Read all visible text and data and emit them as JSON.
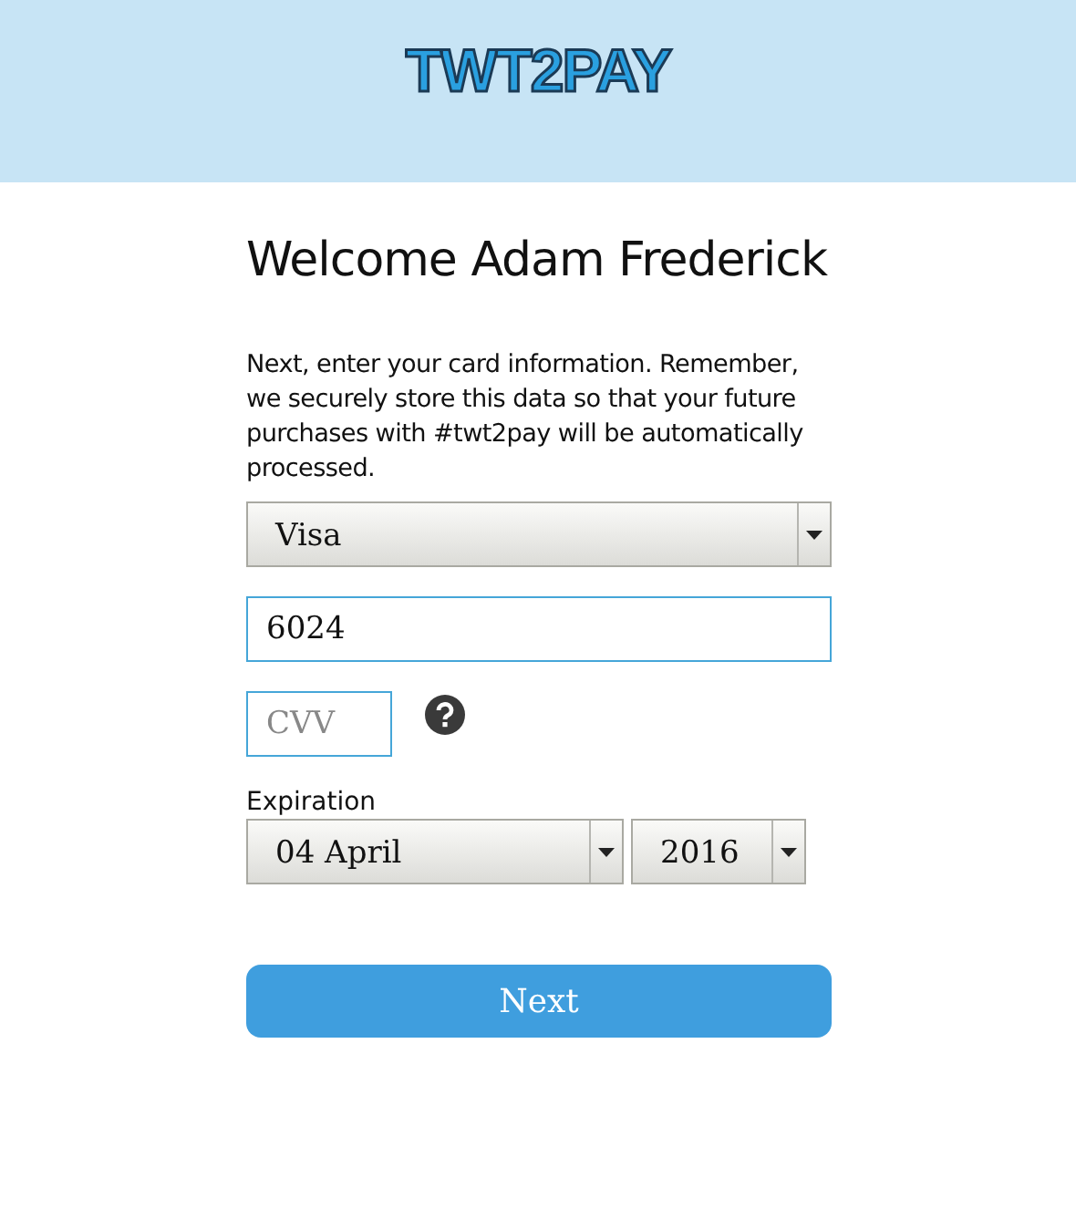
{
  "header": {
    "logo": "TWT2PAY"
  },
  "heading": "Welcome Adam Frederick",
  "intro": "Next, enter your card information. Remember, we securely store this data so that your future purchases with #twt2pay will be automatically processed.",
  "card_type": {
    "value": "Visa"
  },
  "card_number": {
    "value": "6024"
  },
  "cvv": {
    "placeholder": "CVV"
  },
  "expiration": {
    "label": "Expiration",
    "month": "04 April",
    "year": "2016"
  },
  "next_button": "Next"
}
